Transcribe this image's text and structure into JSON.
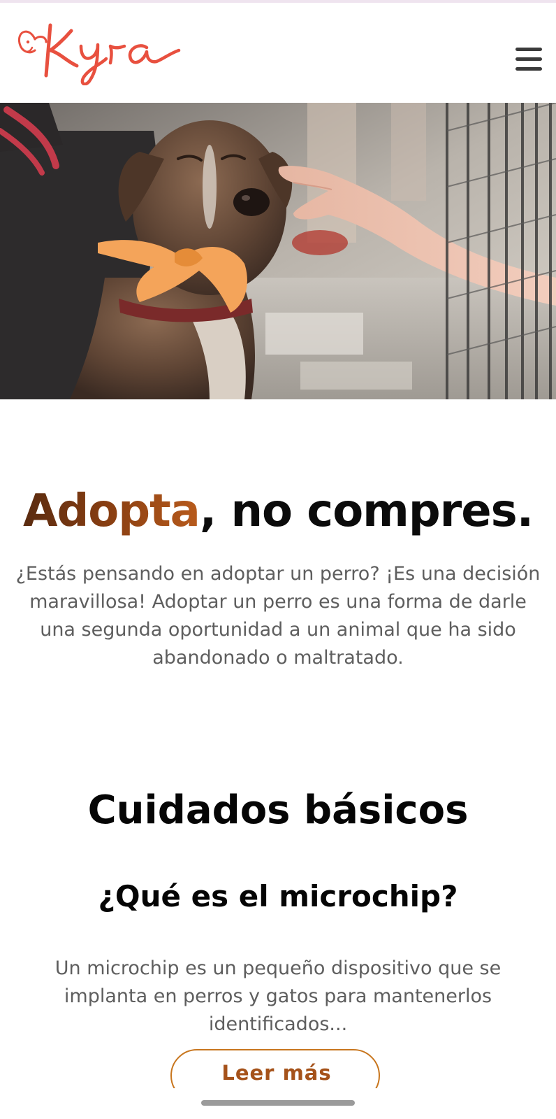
{
  "header": {
    "logo_text": "Kyra",
    "menu_icon": "hamburger-menu-icon"
  },
  "hero": {
    "image_subject": "dog-with-orange-ribbon-being-petted"
  },
  "headline": {
    "accent": "Adopta",
    "rest": ", no compres."
  },
  "intro": {
    "text": "¿Estás pensando en adoptar un perro? ¡Es una decisión maravillosa! Adoptar un perro es una forma de darle una segunda oportunidad a un animal que ha sido abandonado o maltratado."
  },
  "section": {
    "title": "Cuidados básicos",
    "subtitle": "¿Qué es el microchip?",
    "body": "Un microchip es un pequeño dispositivo que se implanta en perros y gatos para mantenerlos identificados...",
    "cta_label": "Leer más"
  },
  "colors": {
    "logo": "#e8503f",
    "accent_brown": "#8a3f12",
    "button_border": "#c8761e",
    "text_gray": "#5e5e5e"
  }
}
